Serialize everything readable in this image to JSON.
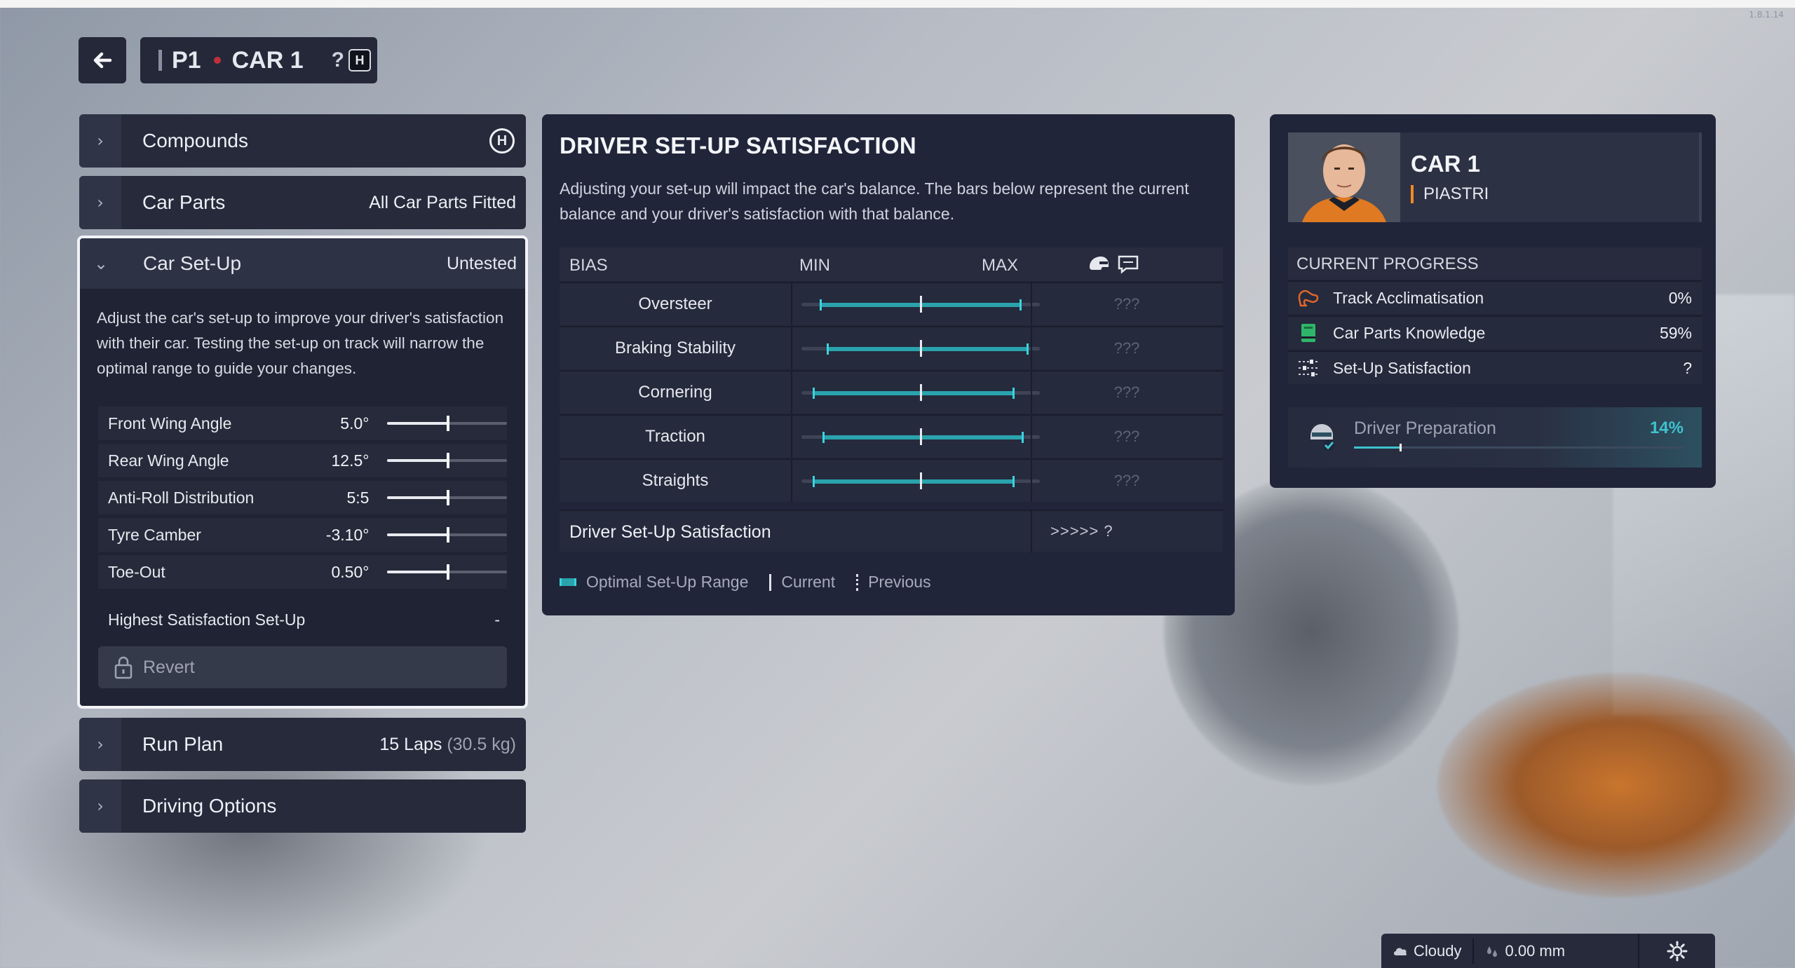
{
  "header": {
    "position": "P1",
    "car": "CAR 1",
    "help": "?",
    "help_key": "H"
  },
  "version": "1.8.1.14",
  "left": {
    "compounds": {
      "label": "Compounds",
      "badge": "H"
    },
    "car_parts": {
      "label": "Car Parts",
      "value": "All Car Parts Fitted"
    },
    "car_setup": {
      "label": "Car Set-Up",
      "value": "Untested",
      "description": "Adjust the car's set-up to improve your driver's satisfaction with their car. Testing the set-up on track will narrow the optimal range to guide your changes.",
      "params": [
        {
          "name": "Front Wing Angle",
          "value": "5.0°",
          "level": 0.5
        },
        {
          "name": "Rear Wing Angle",
          "value": "12.5°",
          "level": 0.5
        },
        {
          "name": "Anti-Roll Distribution",
          "value": "5:5",
          "level": 0.5
        },
        {
          "name": "Tyre Camber",
          "value": "-3.10°",
          "level": 0.5
        },
        {
          "name": "Toe-Out",
          "value": "0.50°",
          "level": 0.5
        }
      ],
      "highest_label": "Highest Satisfaction Set-Up",
      "highest_value": "-",
      "revert": "Revert"
    },
    "run_plan": {
      "label": "Run Plan",
      "value": "15 Laps",
      "value_extra": "(30.5 kg)"
    },
    "driving_options": {
      "label": "Driving Options"
    }
  },
  "center": {
    "title": "DRIVER SET-UP SATISFACTION",
    "description": "Adjusting your set-up will impact the car's balance. The bars below represent the current balance and your driver's satisfaction with that balance.",
    "col_bias": "BIAS",
    "col_min": "MIN",
    "col_max": "MAX",
    "rows": [
      {
        "name": "Oversteer",
        "range": [
          0.08,
          0.92
        ],
        "current": 0.5,
        "sat": "???"
      },
      {
        "name": "Braking Stability",
        "range": [
          0.11,
          0.95
        ],
        "current": 0.5,
        "sat": "???"
      },
      {
        "name": "Cornering",
        "range": [
          0.05,
          0.89
        ],
        "current": 0.5,
        "sat": "???"
      },
      {
        "name": "Traction",
        "range": [
          0.09,
          0.93
        ],
        "current": 0.5,
        "sat": "???"
      },
      {
        "name": "Straights",
        "range": [
          0.05,
          0.89
        ],
        "current": 0.5,
        "sat": "???"
      }
    ],
    "satisfaction_label": "Driver Set-Up Satisfaction",
    "satisfaction_value": ">>>>> ?",
    "legend": {
      "optimal": "Optimal Set-Up Range",
      "current": "Current",
      "previous": "Previous"
    }
  },
  "right": {
    "car": "CAR 1",
    "driver": "PIASTRI",
    "progress_title": "CURRENT PROGRESS",
    "items": [
      {
        "label": "Track Acclimatisation",
        "value": "0%",
        "icon": "track-icon"
      },
      {
        "label": "Car Parts Knowledge",
        "value": "59%",
        "icon": "book-icon"
      },
      {
        "label": "Set-Up Satisfaction",
        "value": "?",
        "icon": "sliders-icon"
      }
    ],
    "prep_label": "Driver Preparation",
    "prep_value": "14%",
    "prep_level": 0.14
  },
  "status": {
    "weather": "Cloudy",
    "rain": "0.00 mm"
  },
  "colors": {
    "accent": "#2aa3ad",
    "accent_bright": "#3fc3cf",
    "orange": "#f08a24",
    "panel": "#21253a"
  }
}
